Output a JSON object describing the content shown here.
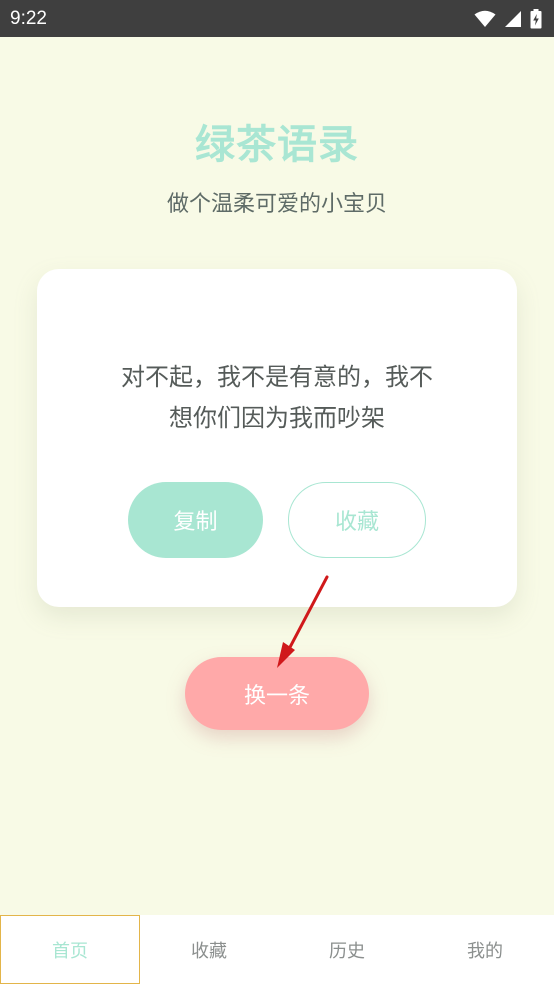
{
  "status_bar": {
    "time": "9:22",
    "icons": [
      "wifi-icon",
      "signal-icon",
      "battery-charging-icon"
    ]
  },
  "header": {
    "title": "绿茶语录",
    "subtitle": "做个温柔可爱的小宝贝"
  },
  "quote_card": {
    "text_line1": "对不起，我不是有意的，我不",
    "text_line2": "想你们因为我而吵架",
    "copy_label": "复制",
    "favorite_label": "收藏"
  },
  "next_button": {
    "label": "换一条"
  },
  "bottom_nav": {
    "items": [
      {
        "label": "首页",
        "active": true
      },
      {
        "label": "收藏",
        "active": false
      },
      {
        "label": "历史",
        "active": false
      },
      {
        "label": "我的",
        "active": false
      }
    ]
  },
  "colors": {
    "background": "#f8fae6",
    "accent_mint": "#a8e6d2",
    "accent_coral": "#ffa9a9",
    "status_bar": "#3f3f3f",
    "annotation_arrow": "#d0191b"
  }
}
